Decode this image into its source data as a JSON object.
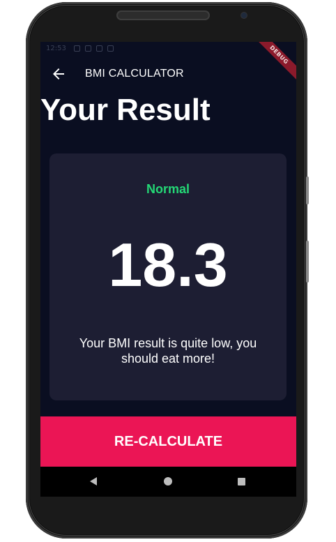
{
  "status_bar": {
    "time": "12:53"
  },
  "debug_banner": "DEBUG",
  "app_bar": {
    "title": "BMI CALCULATOR",
    "back_icon": "arrow-back-icon"
  },
  "page_title": "Your Result",
  "result": {
    "status": "Normal",
    "bmi_value": "18.3",
    "message": "Your BMI result is quite low, you should eat more!"
  },
  "recalculate_label": "RE-CALCULATE",
  "nav_bar": {
    "icons": [
      "nav-back-icon",
      "nav-home-icon",
      "nav-recents-icon"
    ]
  },
  "colors": {
    "background": "#0a0e21",
    "card": "#1d1e33",
    "status_green": "#24d876",
    "accent_pink": "#eb1555"
  }
}
